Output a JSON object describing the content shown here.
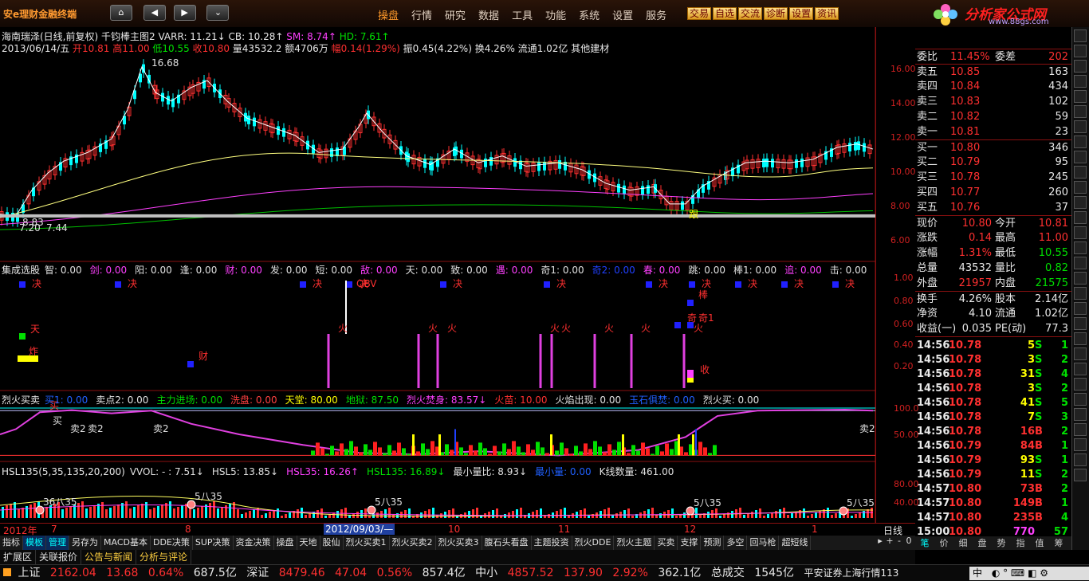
{
  "app": {
    "title": "安e理财金融终端",
    "logo_text": "分析家公式网",
    "logo_url_text": "www.88gs.com"
  },
  "nav": {
    "home": "⌂",
    "back": "◀",
    "fwd": "▶",
    "more": "⌄"
  },
  "menu": [
    "操盘",
    "行情",
    "研究",
    "数据",
    "工具",
    "功能",
    "系统",
    "设置",
    "服务"
  ],
  "quick": [
    "交易",
    "自选",
    "交流",
    "诊断",
    "设置",
    "资讯"
  ],
  "main": {
    "header1": {
      "name": "海南瑞泽(日线,前复权)",
      "indicator": "千钧棒主图2",
      "varr": "VARR: 11.21↓",
      "cb": "CB: 10.28↑",
      "sm": "SM: 8.74↑",
      "hd": "HD: 7.61↑"
    },
    "header2": {
      "date": "2013/06/14/五",
      "open": "开10.81",
      "high": "高11.00",
      "low": "低10.55",
      "close": "收10.80",
      "vol": "量43532.2",
      "amt": "额4706万",
      "chg": "幅0.14(1.29%)",
      "amp": "振0.45(4.22%)",
      "turn": "换4.26%",
      "float": "流通1.02亿",
      "sector": "其他建材"
    },
    "y_labels": [
      "16.00",
      "14.00",
      "12.00",
      "10.00",
      "8.00",
      "6.00"
    ],
    "max_label": "16.68",
    "min_label": "7.20",
    "min_label2": "7.44",
    "min_label3": "8.83",
    "marker": "跟"
  },
  "sub1": {
    "title": "集成选股",
    "items": [
      {
        "t": "智: 0.00",
        "c": "#e0e0e0"
      },
      {
        "t": "剑: 0.00",
        "c": "#ff40ff"
      },
      {
        "t": "阳: 0.00",
        "c": "#e0e0e0"
      },
      {
        "t": "逢: 0.00",
        "c": "#e0e0e0"
      },
      {
        "t": "财: 0.00",
        "c": "#ff40ff"
      },
      {
        "t": "发: 0.00",
        "c": "#e0e0e0"
      },
      {
        "t": "短: 0.00",
        "c": "#e0e0e0"
      },
      {
        "t": "敌: 0.00",
        "c": "#ff40ff"
      },
      {
        "t": "天: 0.00",
        "c": "#e0e0e0"
      },
      {
        "t": "致: 0.00",
        "c": "#e0e0e0"
      },
      {
        "t": "遇: 0.00",
        "c": "#ff40ff"
      },
      {
        "t": "奇1: 0.00",
        "c": "#e0e0e0"
      },
      {
        "t": "奇2: 0.00",
        "c": "#2040ff"
      },
      {
        "t": "春: 0.00",
        "c": "#ff40ff"
      },
      {
        "t": "跳: 0.00",
        "c": "#e0e0e0"
      },
      {
        "t": "棒1: 0.00",
        "c": "#e0e0e0"
      },
      {
        "t": "追: 0.00",
        "c": "#ff40ff"
      },
      {
        "t": "击: 0.00",
        "c": "#e0e0e0"
      }
    ],
    "y_labels": [
      "1.00",
      "0.80",
      "0.60",
      "0.40",
      "0.20"
    ],
    "signals": {
      "jue": "决",
      "huo": "火",
      "tian": "天",
      "cai": "财",
      "zha": "炸",
      "bang": "棒",
      "qi": "奇",
      "qi1": "奇1",
      "shou": "收"
    }
  },
  "sub2": {
    "title": "烈火买卖",
    "items": [
      {
        "t": "买1: 0.00",
        "c": "#2060ff"
      },
      {
        "t": "卖点2: 0.00",
        "c": "#e0e0e0"
      },
      {
        "t": "主力进场: 0.00",
        "c": "#00e000"
      },
      {
        "t": "洗盘: 0.00",
        "c": "#ff4040"
      },
      {
        "t": "天堂: 80.00",
        "c": "#ffff00"
      },
      {
        "t": "地狱: 87.50",
        "c": "#00e000"
      },
      {
        "t": "烈火焚身: 83.57↓",
        "c": "#ff40ff"
      },
      {
        "t": "火苗: 10.00",
        "c": "#ff3030"
      },
      {
        "t": "火焰出现: 0.00",
        "c": "#e0e0e0"
      },
      {
        "t": "玉石俱焚: 0.00",
        "c": "#2060ff"
      },
      {
        "t": "烈火买: 0.00",
        "c": "#e0e0e0"
      }
    ],
    "y_labels": [
      "100.0",
      "50.00"
    ],
    "buy": "买",
    "sell2": "卖2"
  },
  "sub3": {
    "title": "HSL135(5,35,135,20,200)",
    "items": [
      {
        "t": "VVOL: -    : 7.51↓",
        "c": "#e0e0e0"
      },
      {
        "t": "HSL5: 13.85↓",
        "c": "#e0e0e0"
      },
      {
        "t": "HSL35: 16.26↑",
        "c": "#ff40ff"
      },
      {
        "t": "HSL135: 16.89↓",
        "c": "#00e000"
      },
      {
        "t": "最小量比: 8.93↓",
        "c": "#e0e0e0"
      },
      {
        "t": "最小量: 0.00",
        "c": "#2060ff"
      },
      {
        "t": "K线数量: 461.00",
        "c": "#e0e0e0"
      }
    ],
    "y_labels": [
      "80.00",
      "40.00"
    ],
    "cross": "5八35"
  },
  "timeaxis": {
    "year": "2012年",
    "months": [
      "7",
      "8",
      "10",
      "11",
      "12",
      "1"
    ],
    "cursor": "2012/09/03/—",
    "period": "日线"
  },
  "quote": {
    "ratio": {
      "label": "委比",
      "value": "11.45%",
      "label2": "委差",
      "value2": "202"
    },
    "asks": [
      {
        "l": "卖五",
        "p": "10.85",
        "v": "163"
      },
      {
        "l": "卖四",
        "p": "10.84",
        "v": "434"
      },
      {
        "l": "卖三",
        "p": "10.83",
        "v": "102"
      },
      {
        "l": "卖二",
        "p": "10.82",
        "v": "59"
      },
      {
        "l": "卖一",
        "p": "10.81",
        "v": "23"
      }
    ],
    "bids": [
      {
        "l": "买一",
        "p": "10.80",
        "v": "346"
      },
      {
        "l": "买二",
        "p": "10.79",
        "v": "95"
      },
      {
        "l": "买三",
        "p": "10.78",
        "v": "245"
      },
      {
        "l": "买四",
        "p": "10.77",
        "v": "260"
      },
      {
        "l": "买五",
        "p": "10.76",
        "v": "37"
      }
    ],
    "stats1": [
      {
        "a": "现价",
        "av": "10.80",
        "ac": "red",
        "b": "今开",
        "bv": "10.81",
        "bc": "red"
      },
      {
        "a": "涨跌",
        "av": "0.14",
        "ac": "red",
        "b": "最高",
        "bv": "11.00",
        "bc": "red"
      },
      {
        "a": "涨幅",
        "av": "1.31%",
        "ac": "red",
        "b": "最低",
        "bv": "10.55",
        "bc": "grn"
      },
      {
        "a": "总量",
        "av": "43532",
        "ac": "wht",
        "b": "量比",
        "bv": "0.82",
        "bc": "grn"
      },
      {
        "a": "外盘",
        "av": "21957",
        "ac": "red",
        "b": "内盘",
        "bv": "21575",
        "bc": "grn"
      }
    ],
    "stats2": [
      {
        "a": "换手",
        "av": "4.26%",
        "ac": "wht",
        "b": "股本",
        "bv": "2.14亿",
        "bc": "wht"
      },
      {
        "a": "净资",
        "av": "4.10",
        "ac": "wht",
        "b": "流通",
        "bv": "1.02亿",
        "bc": "wht"
      },
      {
        "a": "收益(一)",
        "av": "0.035",
        "ac": "wht",
        "b": "PE(动)",
        "bv": "77.3",
        "bc": "wht"
      }
    ],
    "ticks": [
      {
        "t": "14:56",
        "p": "10.78",
        "v": "5",
        "s": "S",
        "n": "1"
      },
      {
        "t": "14:56",
        "p": "10.78",
        "v": "3",
        "s": "S",
        "n": "2"
      },
      {
        "t": "14:56",
        "p": "10.78",
        "v": "31",
        "s": "S",
        "n": "4"
      },
      {
        "t": "14:56",
        "p": "10.78",
        "v": "3",
        "s": "S",
        "n": "2"
      },
      {
        "t": "14:56",
        "p": "10.78",
        "v": "41",
        "s": "S",
        "n": "5"
      },
      {
        "t": "14:56",
        "p": "10.78",
        "v": "7",
        "s": "S",
        "n": "3"
      },
      {
        "t": "14:56",
        "p": "10.78",
        "v": "16",
        "s": "B",
        "n": "2"
      },
      {
        "t": "14:56",
        "p": "10.79",
        "v": "84",
        "s": "B",
        "n": "1"
      },
      {
        "t": "14:56",
        "p": "10.79",
        "v": "93",
        "s": "S",
        "n": "1"
      },
      {
        "t": "14:56",
        "p": "10.79",
        "v": "11",
        "s": "S",
        "n": "2"
      },
      {
        "t": "14:57",
        "p": "10.80",
        "v": "73",
        "s": "B",
        "n": "2"
      },
      {
        "t": "14:57",
        "p": "10.80",
        "v": "149",
        "s": "B",
        "n": "1"
      },
      {
        "t": "14:57",
        "p": "10.80",
        "v": "235",
        "s": "B",
        "n": "4"
      },
      {
        "t": "15:00",
        "p": "10.80",
        "v": "770",
        "s": "",
        "n": "57"
      }
    ],
    "tabs": [
      "笔",
      "价",
      "细",
      "盘",
      "势",
      "指",
      "值",
      "筹"
    ]
  },
  "btabs": [
    "指标",
    "模板",
    "管理",
    "另存为",
    "MACD基本",
    "DDE决策",
    "SUP决策",
    "资金决策",
    "操盘",
    "天地",
    "股仙",
    "烈火买卖1",
    "烈火买卖2",
    "烈火买卖3",
    "腹石头看盘",
    "主题投资",
    "烈火DDE",
    "烈火主题",
    "买卖",
    "支撑",
    "预测",
    "多空",
    "回马枪",
    "超短线"
  ],
  "btabs_ctrl": [
    "▸",
    "+",
    "-",
    "0"
  ],
  "btabs2": [
    "扩展区",
    "关联报价",
    "公告与新闻",
    "分析与评论"
  ],
  "status": {
    "sh": {
      "l": "上证",
      "v": "2162.04",
      "c": "13.68",
      "p": "0.64%",
      "a": "687.5亿"
    },
    "sz": {
      "l": "深证",
      "v": "8479.46",
      "c": "47.04",
      "p": "0.56%",
      "a": "857.4亿"
    },
    "zx": {
      "l": "中小",
      "v": "4857.52",
      "c": "137.90",
      "p": "2.92%",
      "a": "362.1亿"
    },
    "total": "总成交",
    "total_v": "1545亿",
    "broker": "平安证券上海行情113",
    "ime": "中"
  },
  "colors": {
    "up": "#ff3030",
    "down": "#00ffff",
    "ma1": "#ffffff",
    "ma2": "#ffff80",
    "ma3": "#ff40ff",
    "ma4": "#00c000"
  }
}
